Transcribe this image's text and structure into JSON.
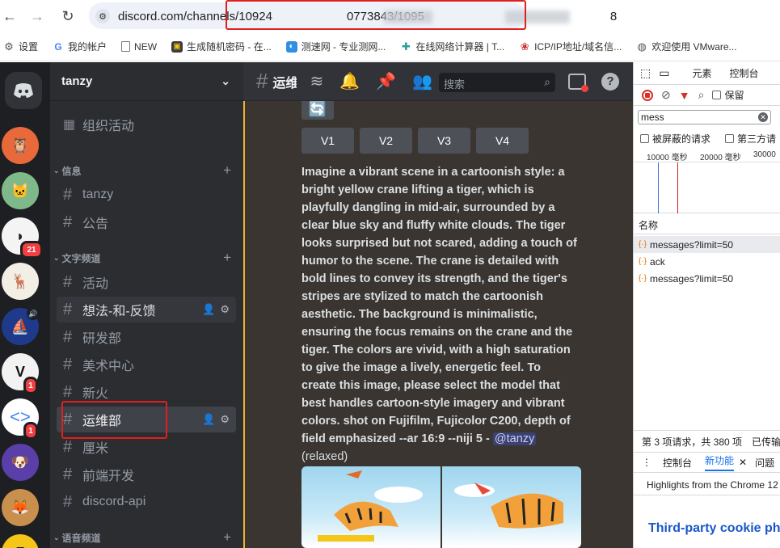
{
  "browser": {
    "url_visible_start": "discord.com/channels/10924",
    "url_visible_mid": "0773843/1095",
    "url_visible_end": "8",
    "bookmarks": [
      {
        "label": "设置",
        "icon": "gear-icon"
      },
      {
        "label": "我的帐户",
        "icon": "google-icon"
      },
      {
        "label": "NEW",
        "icon": "page-icon"
      },
      {
        "label": "生成随机密码 - 在...",
        "icon": "key-icon"
      },
      {
        "label": "测速网 - 专业测网...",
        "icon": "speed-icon"
      },
      {
        "label": "在线网络计算器 | T...",
        "icon": "network-icon"
      },
      {
        "label": "ICP/IP地址/域名信...",
        "icon": "icp-icon"
      },
      {
        "label": "欢迎使用 VMware...",
        "icon": "vmware-icon"
      }
    ]
  },
  "discord": {
    "server_badges": [
      "21",
      "1",
      "1"
    ],
    "guild_name": "tanzy",
    "events_label": "组织活动",
    "categories": {
      "info": "信息",
      "text": "文字频道",
      "voice": "语音频道"
    },
    "channels": [
      {
        "name": "tanzy"
      },
      {
        "name": "公告"
      },
      {
        "name": "活动"
      },
      {
        "name": "想法-和-反馈"
      },
      {
        "name": "研发部"
      },
      {
        "name": "美术中心"
      },
      {
        "name": "新火"
      },
      {
        "name": "运维部"
      },
      {
        "name": "厘米"
      },
      {
        "name": "前端开发"
      },
      {
        "name": "discord-api"
      }
    ],
    "header_title": "运维部",
    "search_placeholder": "搜索",
    "variation_buttons": [
      "V1",
      "V2",
      "V3",
      "V4"
    ],
    "prompt_text": "Imagine a vibrant scene in a cartoonish style: a bright yellow crane lifting a tiger, which is playfully dangling in mid-air, surrounded by a clear blue sky and fluffy white clouds. The tiger looks surprised but not scared, adding a touch of humor to the scene. The crane is detailed with bold lines to convey its strength, and the tiger's stripes are stylized to match the cartoonish aesthetic. The background is minimalistic, ensuring the focus remains on the crane and the tiger. The colors are vivid, with a high saturation to give the image a lively, energetic feel. To create this image, please select the model that best handles cartoon-style imagery and vibrant colors. shot on Fujifilm, Fujicolor C200, depth of field emphasized --ar 16:9 --niji 5",
    "prompt_separator": " - ",
    "mention": "@tanzy",
    "mode": "(relaxed)"
  },
  "devtools": {
    "tab_elements": "元素",
    "tab_console": "控制台",
    "preserve_log": "保留",
    "filter_value": "mess",
    "blocked_requests": "被屏蔽的请求",
    "third_party": "第三方请",
    "ticks": [
      "10000 毫秒",
      "20000 毫秒",
      "30000"
    ],
    "name_header": "名称",
    "requests": [
      "messages?limit=50",
      "ack",
      "messages?limit=50"
    ],
    "status_summary": "第 3 项请求，共 380 项",
    "status_transferred": "已传输",
    "drawer_console": "控制台",
    "drawer_whats_new": "新功能",
    "drawer_issues": "问题",
    "highlights_text": "Highlights from the Chrome 12",
    "third_party_cookie": "Third-party cookie ph"
  }
}
